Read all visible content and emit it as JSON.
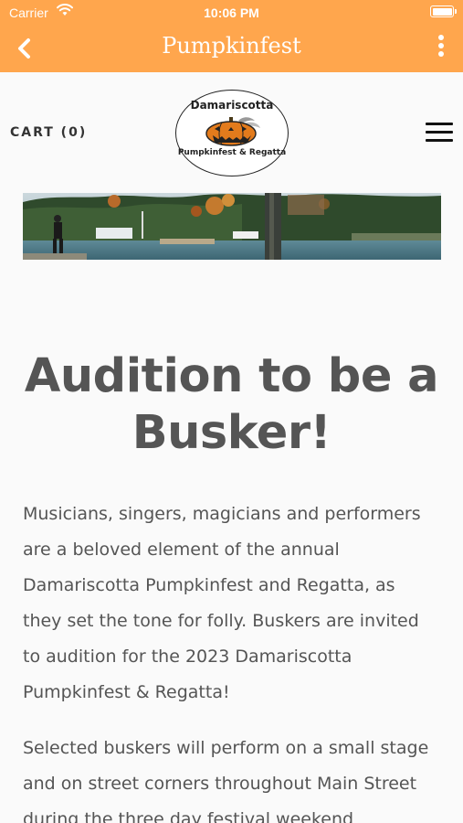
{
  "status_bar": {
    "carrier": "Carrier",
    "time": "10:06 PM"
  },
  "nav": {
    "title": "Pumpkinfest",
    "back_icon": "chevron-left-icon",
    "more_icon": "more-vertical-icon"
  },
  "header": {
    "cart_label": "CART (0)",
    "logo_text_top": "Damariscotta",
    "logo_text_bottom": "Pumpkinfest & Regatta",
    "menu_icon": "hamburger-menu-icon"
  },
  "page": {
    "heading_lines": [
      "Audition to be a",
      "Busker!"
    ],
    "paragraph1_lines": [
      "Musicians, singers, magicians and performers",
      "are a beloved element of the annual",
      "Damariscotta Pumpkinfest and Regatta, as",
      "they set the tone for folly. Buskers are invited",
      "to audition for the 2023 Damariscotta",
      "Pumpkinfest & Regatta!"
    ],
    "paragraph2_lines": [
      "Selected buskers will perform on a small stage",
      "and on street corners throughout Main Street",
      "during the three day festival weekend"
    ]
  },
  "colors": {
    "nav_bg": "#ffa64d",
    "page_bg": "#fafafa",
    "heading": "#555555",
    "body_text": "#555555"
  }
}
